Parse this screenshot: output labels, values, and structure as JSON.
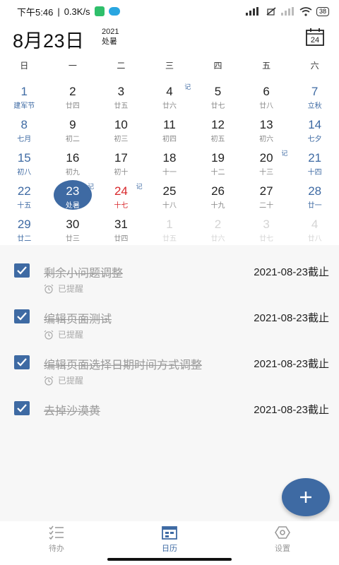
{
  "status_bar": {
    "time": "下午5:46",
    "speed": "0.3K/s",
    "battery": "38"
  },
  "header": {
    "date_title": "8月23日",
    "year": "2021",
    "solar_term": "处暑",
    "calendar_icon_day": "24"
  },
  "weekdays": [
    "日",
    "一",
    "二",
    "三",
    "四",
    "五",
    "六"
  ],
  "calendar": {
    "rows": [
      [
        {
          "day": "1",
          "lunar": "建军节",
          "style": "blue"
        },
        {
          "day": "2",
          "lunar": "廿四",
          "style": ""
        },
        {
          "day": "3",
          "lunar": "廿五",
          "style": ""
        },
        {
          "day": "4",
          "lunar": "廿六",
          "style": "",
          "note": "记"
        },
        {
          "day": "5",
          "lunar": "廿七",
          "style": ""
        },
        {
          "day": "6",
          "lunar": "廿八",
          "style": ""
        },
        {
          "day": "7",
          "lunar": "立秋",
          "style": "blue"
        }
      ],
      [
        {
          "day": "8",
          "lunar": "七月",
          "style": "blue"
        },
        {
          "day": "9",
          "lunar": "初二",
          "style": ""
        },
        {
          "day": "10",
          "lunar": "初三",
          "style": ""
        },
        {
          "day": "11",
          "lunar": "初四",
          "style": ""
        },
        {
          "day": "12",
          "lunar": "初五",
          "style": ""
        },
        {
          "day": "13",
          "lunar": "初六",
          "style": ""
        },
        {
          "day": "14",
          "lunar": "七夕",
          "style": "blue"
        }
      ],
      [
        {
          "day": "15",
          "lunar": "初八",
          "style": "blue"
        },
        {
          "day": "16",
          "lunar": "初九",
          "style": ""
        },
        {
          "day": "17",
          "lunar": "初十",
          "style": ""
        },
        {
          "day": "18",
          "lunar": "十一",
          "style": ""
        },
        {
          "day": "19",
          "lunar": "十二",
          "style": ""
        },
        {
          "day": "20",
          "lunar": "十三",
          "style": "",
          "note": "记"
        },
        {
          "day": "21",
          "lunar": "十四",
          "style": "blue"
        }
      ],
      [
        {
          "day": "22",
          "lunar": "十五",
          "style": "blue"
        },
        {
          "day": "23",
          "lunar": "处暑",
          "style": "selected",
          "note": "记"
        },
        {
          "day": "24",
          "lunar": "十七",
          "style": "red",
          "note": "记"
        },
        {
          "day": "25",
          "lunar": "十八",
          "style": ""
        },
        {
          "day": "26",
          "lunar": "十九",
          "style": ""
        },
        {
          "day": "27",
          "lunar": "二十",
          "style": ""
        },
        {
          "day": "28",
          "lunar": "廿一",
          "style": "blue"
        }
      ],
      [
        {
          "day": "29",
          "lunar": "廿二",
          "style": "blue"
        },
        {
          "day": "30",
          "lunar": "廿三",
          "style": ""
        },
        {
          "day": "31",
          "lunar": "廿四",
          "style": ""
        },
        {
          "day": "1",
          "lunar": "廿五",
          "style": "faded"
        },
        {
          "day": "2",
          "lunar": "廿六",
          "style": "faded"
        },
        {
          "day": "3",
          "lunar": "廿七",
          "style": "faded"
        },
        {
          "day": "4",
          "lunar": "廿八",
          "style": "faded"
        }
      ]
    ]
  },
  "tasks": [
    {
      "title": "剩余小问题调整",
      "date": "2021-08-23截止",
      "reminder": "已提醒",
      "checked": true
    },
    {
      "title": "编辑页面测试",
      "date": "2021-08-23截止",
      "reminder": "已提醒",
      "checked": true
    },
    {
      "title": "编辑页面选择日期时间方式调整",
      "date": "2021-08-23截止",
      "reminder": "已提醒",
      "checked": true
    },
    {
      "title": "去掉沙漠黄",
      "date": "2021-08-23截止",
      "reminder": "",
      "checked": true
    }
  ],
  "bottom_nav": {
    "todo": "待办",
    "calendar": "日历",
    "settings": "设置"
  },
  "colors": {
    "accent": "#3e6aa3",
    "holiday_red": "#d8262a",
    "task_background": "#f7f7f7"
  }
}
